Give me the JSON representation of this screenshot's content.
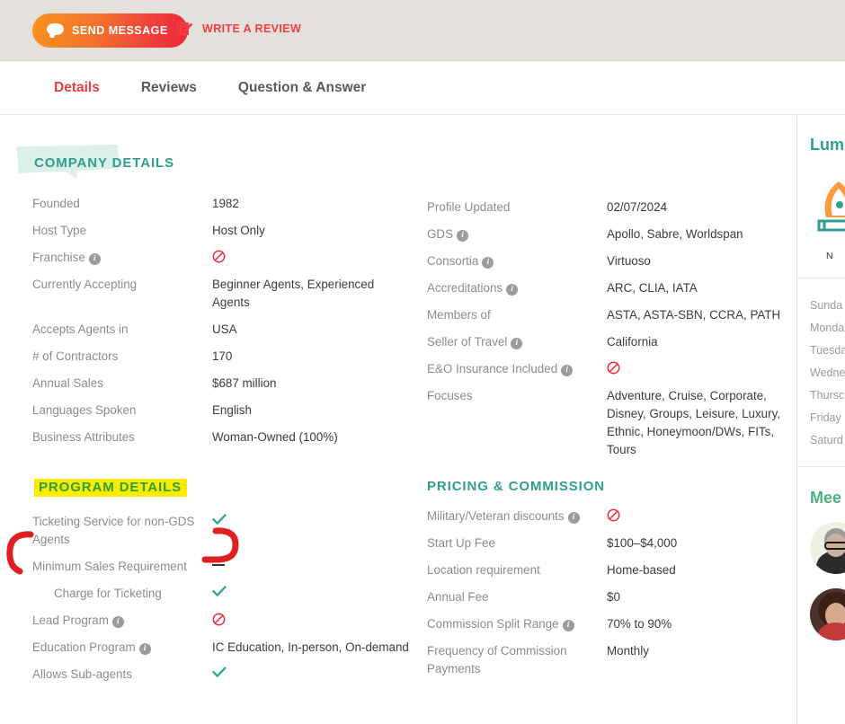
{
  "action_bar": {
    "send_message_label": "SEND MESSAGE",
    "write_review_label": "WRITE A REVIEW",
    "send_message_icon": "chat-bubble-icon",
    "write_review_icon": "pencil-edit-icon",
    "background_color": "#e4e1dc",
    "button_gradient_from": "#f7941e",
    "button_gradient_to": "#ee2737",
    "link_color": "#ef3e42"
  },
  "tabs": [
    {
      "label": "Details",
      "active": true
    },
    {
      "label": "Reviews",
      "active": false
    },
    {
      "label": "Question & Answer",
      "active": false
    }
  ],
  "company_details": {
    "title": "COMPANY DETAILS",
    "accent_color": "#2e9e8f",
    "left_rows": [
      {
        "label": "Founded",
        "info": false,
        "value": "1982",
        "type": "text"
      },
      {
        "label": "Host Type",
        "info": false,
        "value": "Host Only",
        "type": "text"
      },
      {
        "label": "Franchise",
        "info": true,
        "value": "no",
        "type": "icon"
      },
      {
        "label": "Currently Accepting",
        "info": false,
        "value": "Beginner Agents, Experienced Agents",
        "type": "text"
      },
      {
        "label": "Accepts Agents in",
        "info": false,
        "value": "USA",
        "type": "text"
      },
      {
        "label": "# of Contractors",
        "info": false,
        "value": "170",
        "type": "text"
      },
      {
        "label": "Annual Sales",
        "info": false,
        "value": "$687 million",
        "type": "text"
      },
      {
        "label": "Languages Spoken",
        "info": false,
        "value": "English",
        "type": "text"
      },
      {
        "label": "Business Attributes",
        "info": false,
        "value": "Woman-Owned (100%)",
        "type": "text"
      }
    ],
    "right_rows": [
      {
        "label": "Profile Updated",
        "info": false,
        "value": "02/07/2024",
        "type": "text"
      },
      {
        "label": "GDS",
        "info": true,
        "value": "Apollo, Sabre, Worldspan",
        "type": "text"
      },
      {
        "label": "Consortia",
        "info": true,
        "value": "Virtuoso",
        "type": "link"
      },
      {
        "label": "Accreditations",
        "info": true,
        "value": "ARC, CLIA, IATA",
        "type": "text"
      },
      {
        "label": "Members of",
        "info": false,
        "value": "ASTA, ASTA-SBN, CCRA, PATH",
        "type": "text"
      },
      {
        "label": "Seller of Travel",
        "info": true,
        "value": "California",
        "type": "text"
      },
      {
        "label": "E&O Insurance Included",
        "info": true,
        "value": "no",
        "type": "icon"
      },
      {
        "label": "Focuses",
        "info": false,
        "value": "Adventure, Cruise, Corporate, Disney, Groups, Leisure, Luxury, Ethnic, Honeymoon/DWs, FITs, Tours",
        "type": "text"
      }
    ]
  },
  "program_details": {
    "title": "PROGRAM DETAILS",
    "highlight_color": "#fcec00",
    "title_color": "#2e9e37",
    "rows": [
      {
        "label": "Ticketing Service for non-GDS Agents",
        "info": false,
        "value": "yes",
        "type": "icon",
        "indent": false
      },
      {
        "label": "Minimum Sales Requirement",
        "info": false,
        "value": "dash",
        "type": "icon",
        "indent": false
      },
      {
        "label": "Charge for Ticketing",
        "info": false,
        "value": "yes",
        "type": "icon",
        "indent": true
      },
      {
        "label": "Lead Program",
        "info": true,
        "value": "no",
        "type": "icon",
        "indent": false
      },
      {
        "label": "Education Program",
        "info": true,
        "value": "IC Education, In-person, On-demand",
        "type": "text",
        "indent": false
      },
      {
        "label": "Allows Sub-agents",
        "info": false,
        "value": "yes",
        "type": "icon",
        "indent": false
      }
    ]
  },
  "pricing_commission": {
    "title": "PRICING & COMMISSION",
    "accent_color": "#2e9e8f",
    "rows": [
      {
        "label": "Military/Veteran discounts",
        "info": true,
        "value": "no",
        "type": "icon"
      },
      {
        "label": "Start Up Fee",
        "info": false,
        "value": "$100–$4,000",
        "type": "text"
      },
      {
        "label": "Location requirement",
        "info": false,
        "value": "Home-based",
        "type": "text"
      },
      {
        "label": "Annual Fee",
        "info": false,
        "value": "$0",
        "type": "text"
      },
      {
        "label": "Commission Split Range",
        "info": true,
        "value": "70% to 90%",
        "type": "text"
      },
      {
        "label": "Frequency of Commission Payments",
        "info": false,
        "value": "Monthly",
        "type": "text"
      }
    ]
  },
  "annotations": {
    "highlight_target": "PROGRAM DETAILS",
    "bracket_color": "#e02020",
    "bracket_target": "Ticketing Service for non-GDS Agents"
  },
  "sidebar": {
    "assistant_title": "Lum",
    "assistant_name": "N",
    "hours": [
      "Sunda",
      "Monda",
      "Tuesda",
      "Wedne",
      "Thursc",
      "Friday",
      "Saturd"
    ],
    "meet_title": "Mee"
  }
}
